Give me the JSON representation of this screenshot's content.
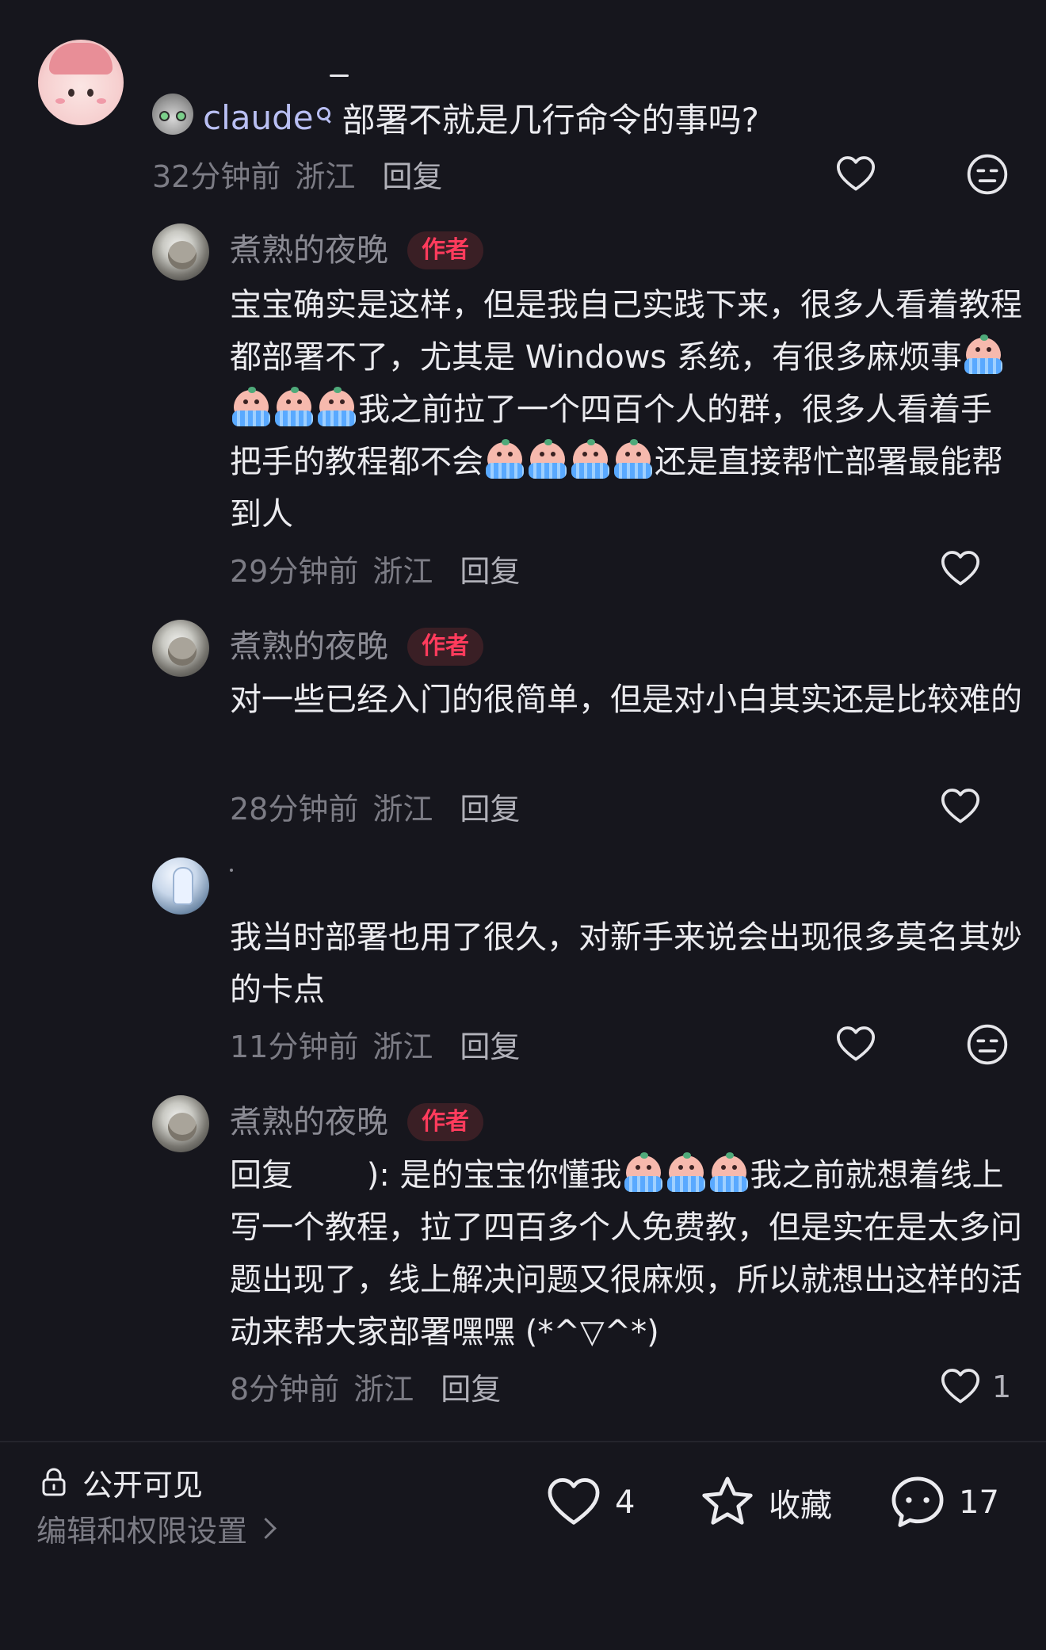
{
  "comment": {
    "username": "claude",
    "text": "部署不就是几行命令的事吗?",
    "time": "32分钟前",
    "region": "浙江",
    "reply_label": "回复"
  },
  "replies": [
    {
      "author": "煮熟的夜晚",
      "badge": "作者",
      "segments": [
        "宝宝确实是这样，但是我自己实践下来，很多人看着教程都部署不了，尤其是 Windows 系统，有很多麻烦事",
        "我之前拉了一个四百个人的群，很多人看着手把手的教程都不会",
        "还是直接帮忙部署最能帮到人"
      ],
      "time": "29分钟前",
      "region": "浙江",
      "reply_label": "回复"
    },
    {
      "author": "煮熟的夜晚",
      "badge": "作者",
      "text": "对一些已经入门的很简单，但是对小白其实还是比较难的",
      "time": "28分钟前",
      "region": "浙江",
      "reply_label": "回复"
    },
    {
      "author": "",
      "text": "我当时部署也用了很久，对新手来说会出现很多莫名其妙的卡点",
      "time": "11分钟前",
      "region": "浙江",
      "reply_label": "回复"
    },
    {
      "author": "煮熟的夜晚",
      "badge": "作者",
      "reply_prefix": "回复",
      "reply_target": "   ):",
      "segments": [
        " 是的宝宝你懂我",
        "我之前就想着线上写一个教程，拉了四百多个人免费教，但是实在是太多问题出现了，线上解决问题又很麻烦，所以就想出这样的活动来帮大家部署嘿嘿 (*^▽^*)"
      ],
      "time": "8分钟前",
      "region": "浙江",
      "reply_label": "回复",
      "likes": "1"
    }
  ],
  "footer": {
    "visibility": "公开可见",
    "edit_label": "编辑和权限设置",
    "likes": "4",
    "favorite_label": "收藏",
    "comments": "17"
  },
  "colors": {
    "background": "#16161d",
    "author_badge": "#ff3b5c",
    "username_highlight": "#b9bff3"
  }
}
